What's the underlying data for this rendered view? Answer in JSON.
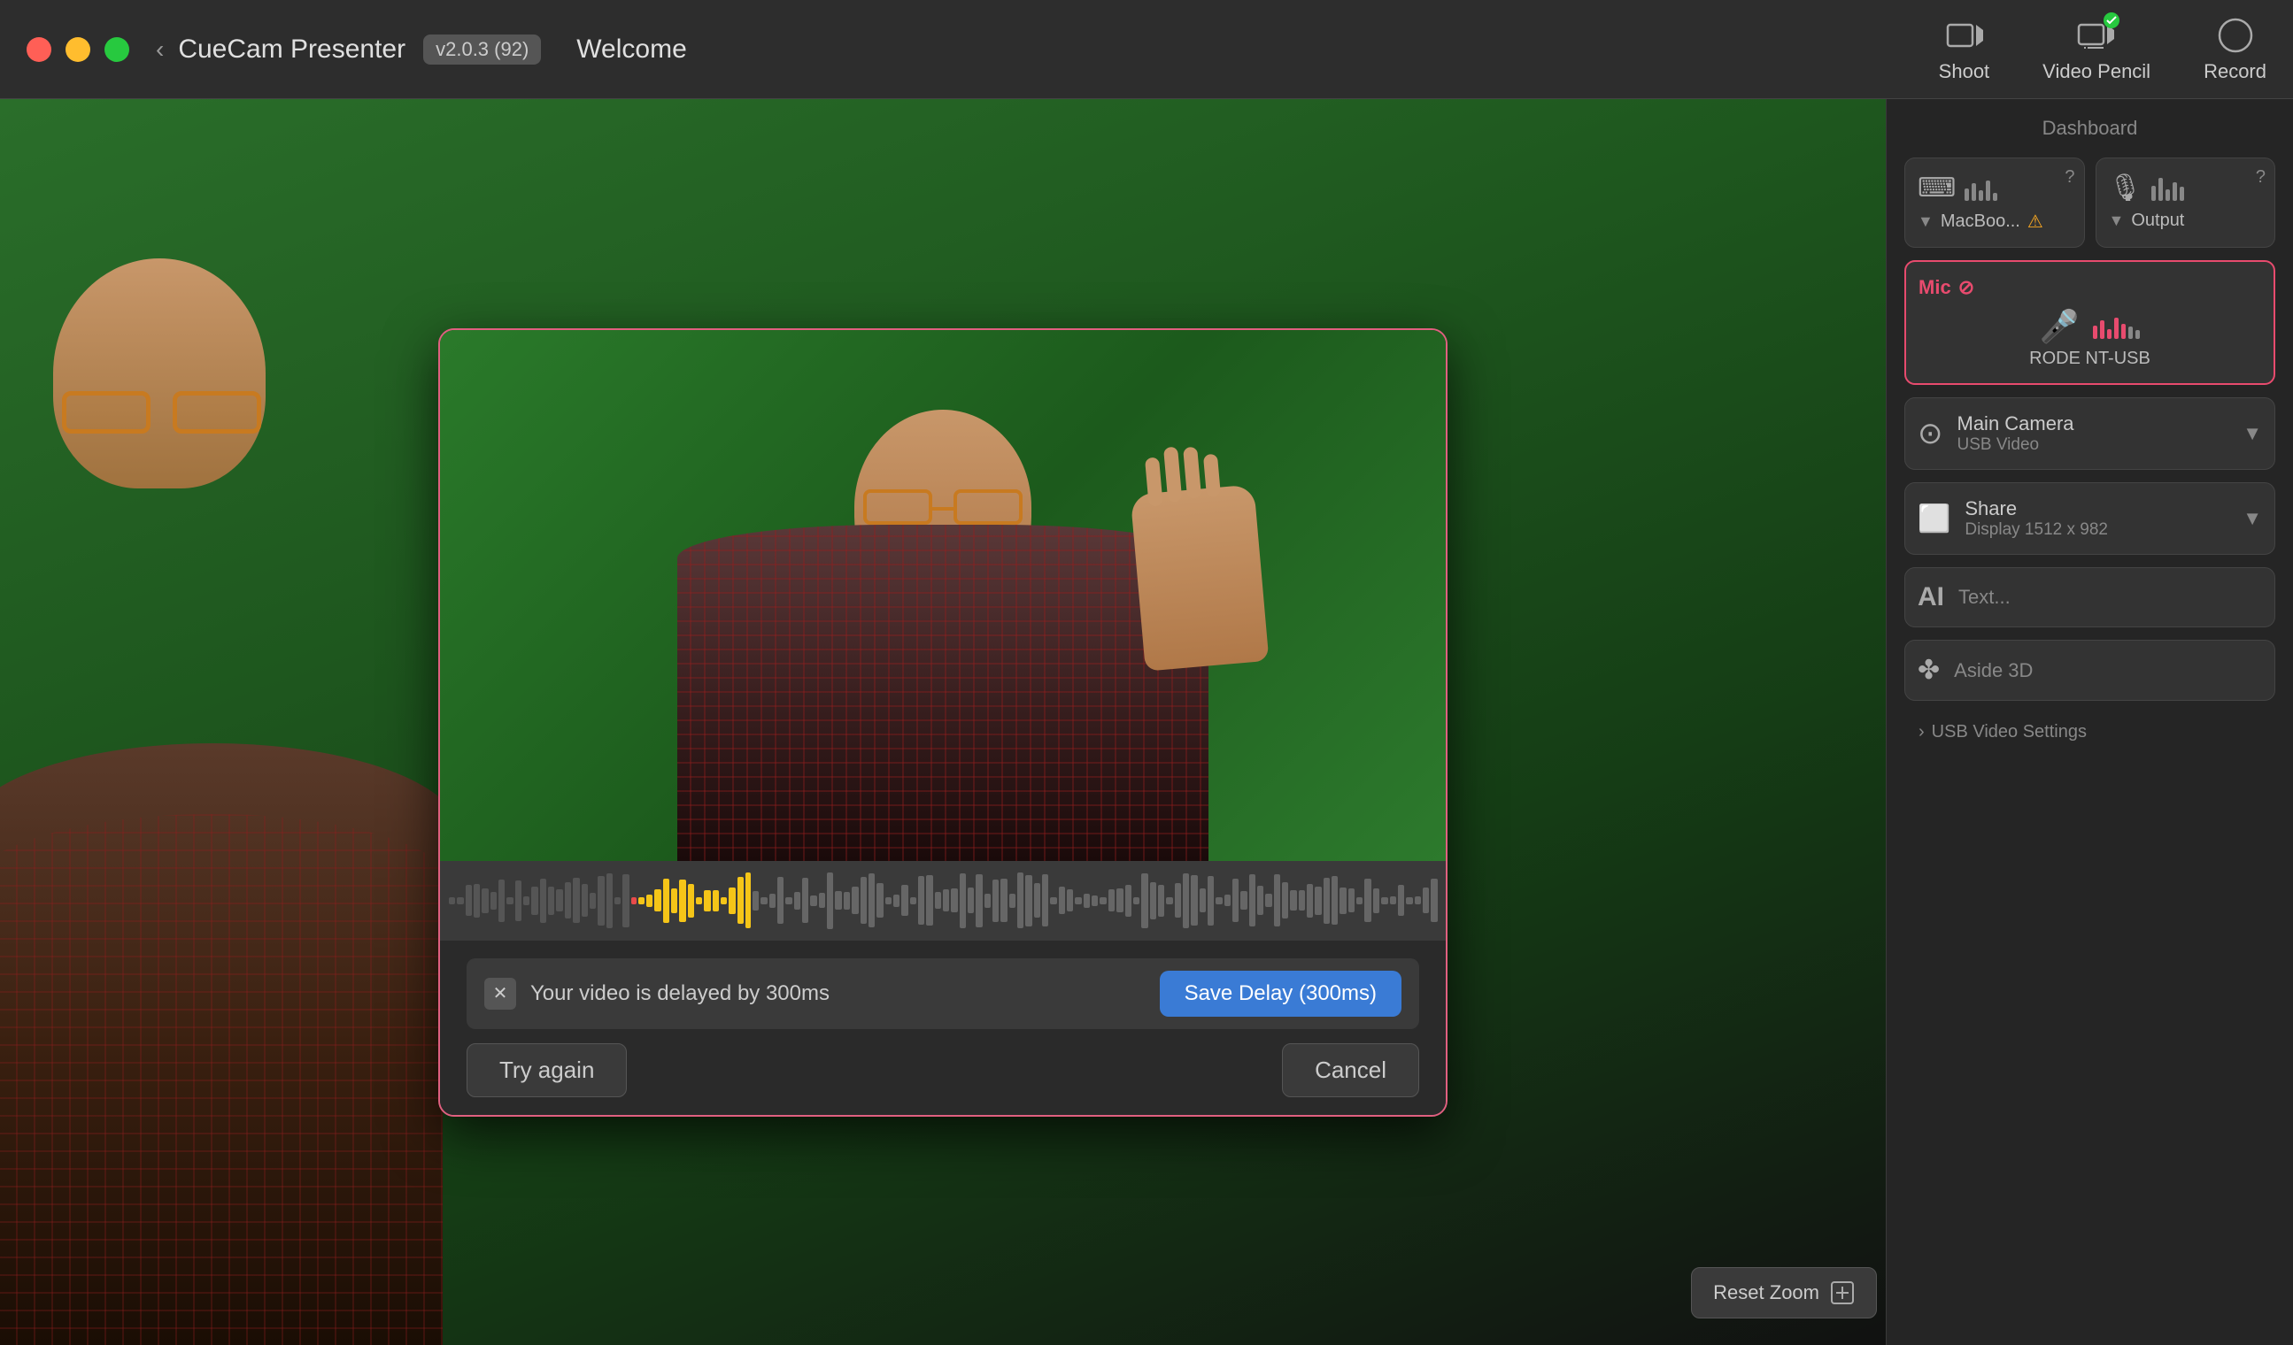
{
  "titlebar": {
    "app_name": "CueCam Presenter",
    "version": "v2.0.3 (92)",
    "welcome": "Welcome",
    "back_label": "‹",
    "shoot_label": "Shoot",
    "video_pencil_label": "Video Pencil",
    "record_label": "Record"
  },
  "sidebar": {
    "dashboard_label": "Dashboard",
    "input_label": "MacBoo...",
    "output_label": "Output",
    "mic_title": "Mic",
    "mic_device": "RODE NT-USB",
    "main_camera_title": "Main Camera",
    "main_camera_sub": "USB Video",
    "share_title": "Share",
    "share_sub": "Display 1512 x 982",
    "text_label": "Text...",
    "aside_label": "Aside 3D",
    "settings_label": "USB Video Settings"
  },
  "modal": {
    "delay_text": "Your video is delayed by 300ms",
    "save_btn": "Save Delay (300ms)",
    "try_again_btn": "Try again",
    "cancel_btn": "Cancel",
    "close_x": "✕"
  },
  "footer": {
    "reset_zoom": "Reset Zoom"
  }
}
